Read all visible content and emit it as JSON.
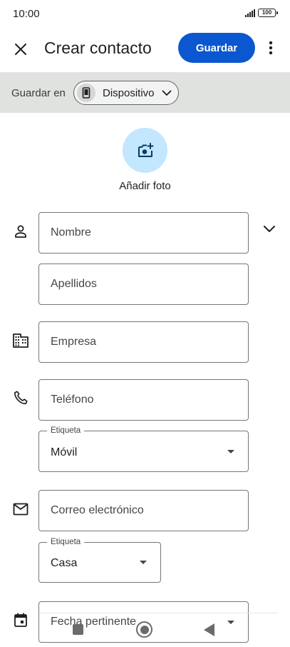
{
  "status_bar": {
    "time": "10:00",
    "battery": "100"
  },
  "app_bar": {
    "title": "Crear contacto",
    "save_label": "Guardar"
  },
  "save_in": {
    "label": "Guardar en",
    "account": "Dispositivo"
  },
  "photo": {
    "label": "Añadir foto"
  },
  "fields": {
    "first_name_placeholder": "Nombre",
    "last_name_placeholder": "Apellidos",
    "company_placeholder": "Empresa",
    "phone_placeholder": "Teléfono",
    "phone_label_legend": "Etiqueta",
    "phone_label_value": "Móvil",
    "email_placeholder": "Correo electrónico",
    "email_label_legend": "Etiqueta",
    "email_label_value": "Casa",
    "date_placeholder": "Fecha pertinente"
  },
  "colors": {
    "accent": "#0b57d0",
    "save_in_bar_bg": "#e0e2df",
    "photo_circle_bg": "#c2e7ff"
  },
  "icons": {
    "close": "close-icon",
    "more": "more-vert-icon",
    "device": "phone-icon",
    "add_photo": "add-photo-icon",
    "person": "person-icon",
    "company": "business-icon",
    "phone": "phone-call-icon",
    "email": "mail-icon",
    "date": "calendar-icon",
    "expand": "chevron-down-icon"
  }
}
